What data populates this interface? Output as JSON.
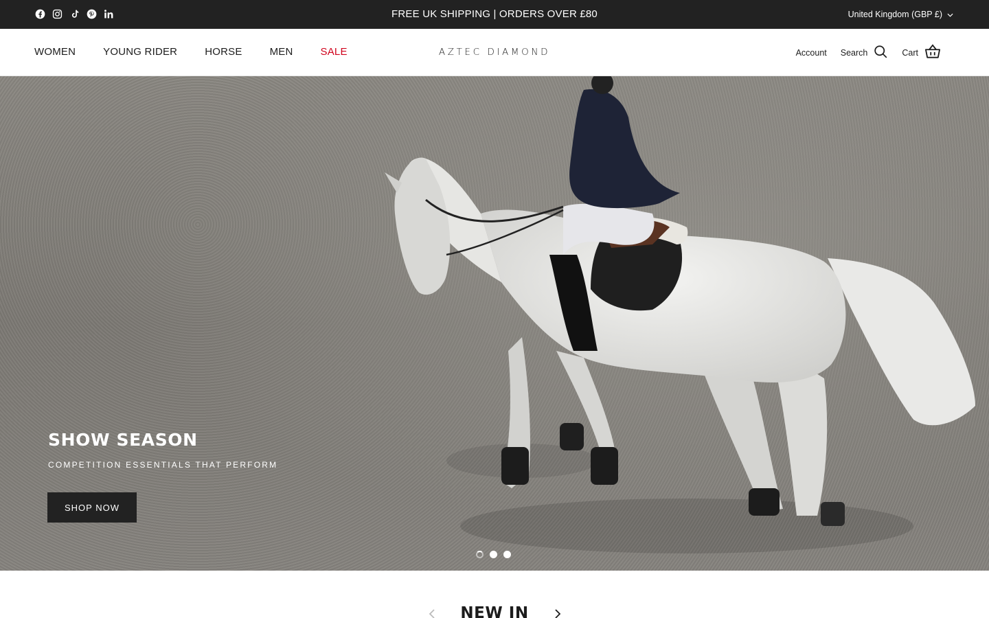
{
  "announcement": {
    "text": "FREE UK SHIPPING | ORDERS OVER £80",
    "social_icons": [
      "facebook-icon",
      "instagram-icon",
      "tiktok-icon",
      "pinterest-icon",
      "linkedin-icon"
    ],
    "country_selector": "United Kingdom (GBP £)"
  },
  "header": {
    "nav": [
      {
        "label": "WOMEN"
      },
      {
        "label": "YOUNG RIDER"
      },
      {
        "label": "HORSE"
      },
      {
        "label": "MEN"
      },
      {
        "label": "SALE",
        "color": "#d0021b"
      }
    ],
    "logo": "AZTEC DIAMOND",
    "account_label": "Account",
    "search_label": "Search",
    "cart_label": "Cart"
  },
  "hero": {
    "title": "SHOW SEASON",
    "subtitle": "COMPETITION ESSENTIALS THAT PERFORM",
    "button_label": "SHOP NOW",
    "slide_count": 3,
    "active_slide": 1
  },
  "section": {
    "title": "NEW IN"
  },
  "colors": {
    "announcement_bg": "#222222",
    "sale": "#d0021b",
    "button_bg": "#222222"
  }
}
